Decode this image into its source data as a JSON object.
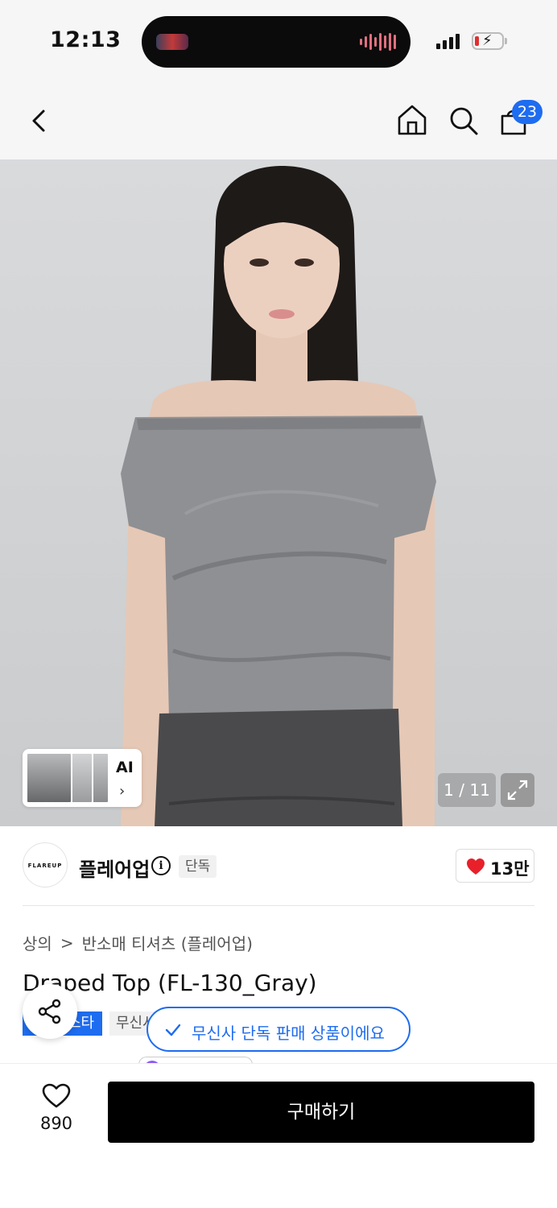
{
  "status_bar": {
    "time": "12:13",
    "battery_color": "#e03030"
  },
  "header": {
    "cart_count": "23",
    "icons": [
      "back-chevron-icon",
      "home-icon",
      "search-icon",
      "shopping-bag-icon"
    ]
  },
  "gallery": {
    "counter": "1 / 11",
    "ai_label": "AI",
    "ai_chevron": "›"
  },
  "brand": {
    "logo_text": "FLAREUP",
    "name": "플레어업",
    "info_symbol": "i",
    "exclusive_tag": "단독",
    "like_count": "13만",
    "heart_color": "#e8202a"
  },
  "product": {
    "breadcrumb": [
      "상의",
      "반소매 티셔츠 (플레어업)"
    ],
    "breadcrumb_sep": ">",
    "title": "Draped Top (FL-130_Gray)",
    "tag_blue": "스타",
    "tag_gray": "무신사"
  },
  "toast": {
    "message": "무신사 단독 판매 상품이에요",
    "accent": "#1e6cf0"
  },
  "bottom_bar": {
    "wish_count": "890",
    "buy_label": "구매하기"
  }
}
